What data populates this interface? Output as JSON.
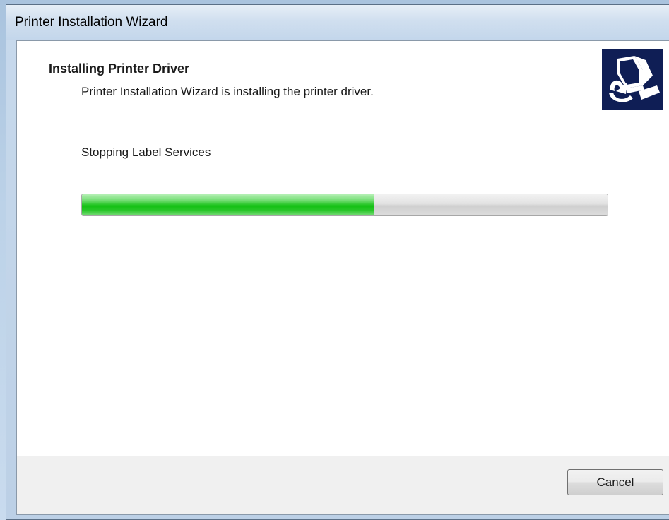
{
  "window": {
    "title": "Printer Installation Wizard"
  },
  "header": {
    "title": "Installing Printer Driver",
    "subtitle": "Printer Installation Wizard is installing the printer driver.",
    "logo_icon": "printer-logo-icon"
  },
  "status": {
    "text": "Stopping Label Services",
    "progress": 0.555
  },
  "footer": {
    "cancel_label": "Cancel"
  },
  "colors": {
    "progress_fill": "#14c014",
    "logo_background": "#0f1e55"
  }
}
